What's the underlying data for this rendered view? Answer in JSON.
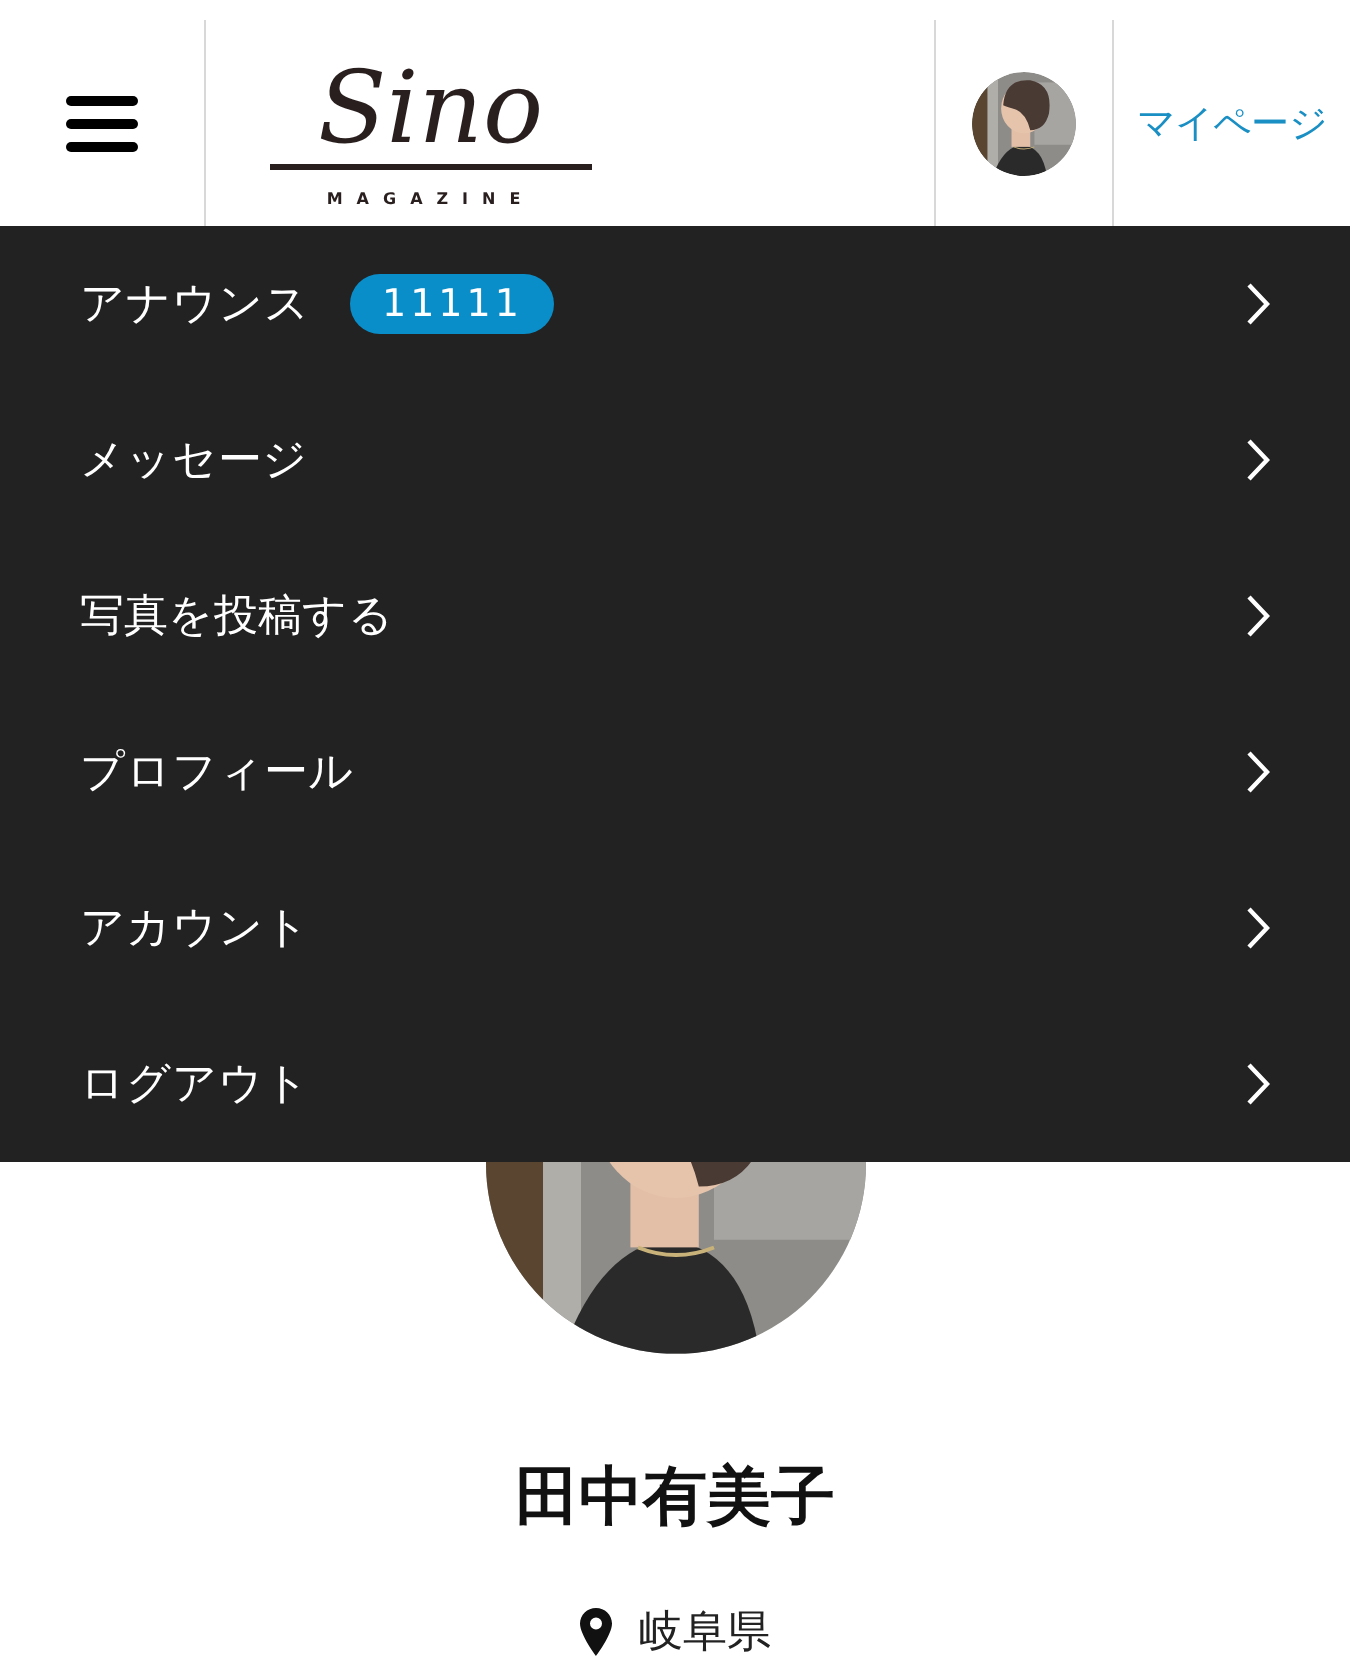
{
  "header": {
    "logo": {
      "title": "Sino",
      "subtitle": "MAGAZINE"
    },
    "mypage_link": "マイページ"
  },
  "menu": {
    "items": [
      {
        "label": "アナウンス",
        "badge": "11111"
      },
      {
        "label": "メッセージ"
      },
      {
        "label": "写真を投稿する"
      },
      {
        "label": "プロフィール"
      },
      {
        "label": "アカウント"
      },
      {
        "label": "ログアウト"
      }
    ]
  },
  "profile": {
    "name": "田中有美子",
    "location": "岐阜県"
  }
}
